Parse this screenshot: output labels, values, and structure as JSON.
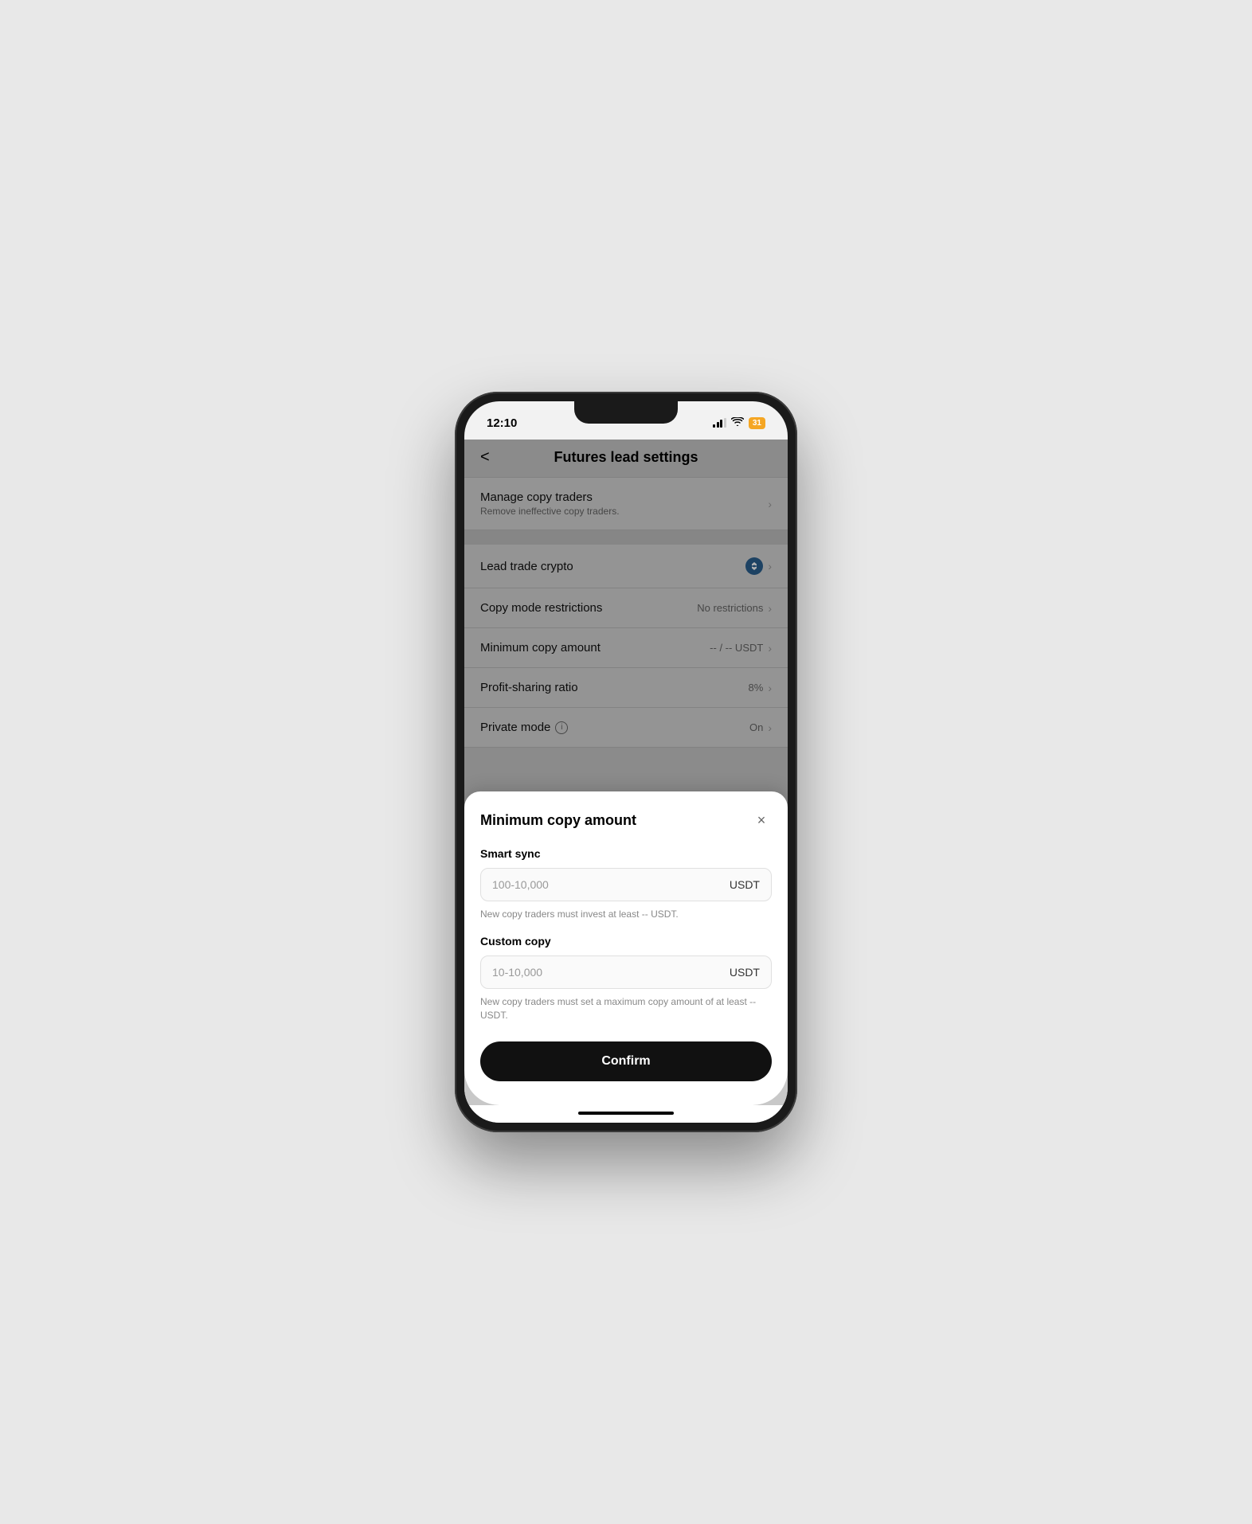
{
  "statusBar": {
    "time": "12:10",
    "battery": "31"
  },
  "header": {
    "backLabel": "<",
    "title": "Futures lead settings"
  },
  "settingsItems": [
    {
      "id": "manage-copy-traders",
      "title": "Manage copy traders",
      "subtitle": "Remove ineffective copy traders.",
      "rightText": "",
      "showChevron": true,
      "showCryptoIcon": false
    },
    {
      "id": "lead-trade-crypto",
      "title": "Lead trade crypto",
      "subtitle": "",
      "rightText": "",
      "showChevron": true,
      "showCryptoIcon": true
    },
    {
      "id": "copy-mode-restrictions",
      "title": "Copy mode restrictions",
      "subtitle": "",
      "rightText": "No restrictions",
      "showChevron": true,
      "showCryptoIcon": false
    },
    {
      "id": "minimum-copy-amount",
      "title": "Minimum copy amount",
      "subtitle": "",
      "rightText": "-- / -- USDT",
      "showChevron": true,
      "showCryptoIcon": false
    },
    {
      "id": "profit-sharing-ratio",
      "title": "Profit-sharing ratio",
      "subtitle": "",
      "rightText": "8%",
      "showChevron": true,
      "showCryptoIcon": false
    },
    {
      "id": "private-mode",
      "title": "Private mode",
      "subtitle": "",
      "rightText": "On",
      "showChevron": true,
      "showCryptoIcon": false,
      "showInfo": true
    }
  ],
  "modal": {
    "title": "Minimum copy amount",
    "closeLabel": "×",
    "smartSync": {
      "label": "Smart sync",
      "placeholder": "100-10,000",
      "currency": "USDT",
      "hint": "New copy traders must invest at least -- USDT."
    },
    "customCopy": {
      "label": "Custom copy",
      "placeholder": "10-10,000",
      "currency": "USDT",
      "hint": "New copy traders must set a maximum copy amount of at least -- USDT."
    },
    "confirmLabel": "Confirm"
  },
  "cryptoIcon": {
    "symbol": "◈"
  },
  "homeBar": {}
}
